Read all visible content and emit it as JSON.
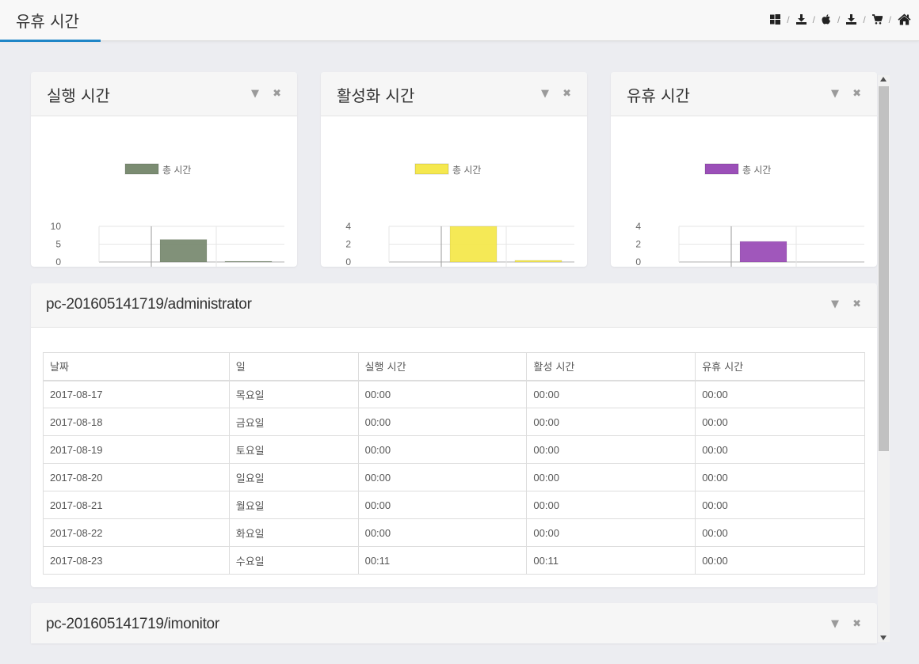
{
  "header": {
    "title": "유휴 시간",
    "icons": [
      "windows-icon",
      "download-icon",
      "apple-icon",
      "download-icon",
      "cart-icon",
      "home-icon"
    ],
    "separator": "/"
  },
  "charts": [
    {
      "title": "실행 시간",
      "chart_data": {
        "type": "bar",
        "legend": "총 시간",
        "color": "#7b8c72",
        "categories": [
          "pc-201605141719/imonitor",
          "pc-201605141719/administrator"
        ],
        "values": [
          6.3,
          0.18
        ],
        "ylim": [
          0,
          10
        ],
        "yticks": [
          "10",
          "5",
          "0"
        ]
      }
    },
    {
      "title": "활성화 시간",
      "chart_data": {
        "type": "bar",
        "legend": "총 시간",
        "color": "#f5e84e",
        "categories": [
          "pc-201605141719/imonitor",
          "pc-201605141719/administrator"
        ],
        "values": [
          4.0,
          0.18
        ],
        "ylim": [
          0,
          4
        ],
        "yticks": [
          "4",
          "2",
          "0"
        ]
      }
    },
    {
      "title": "유휴 시간",
      "chart_data": {
        "type": "bar",
        "legend": "총 시간",
        "color": "#9b4fb8",
        "categories": [
          "pc-201605141719/imonitor",
          "pc-201605141719/administrator"
        ],
        "values": [
          2.3,
          0
        ],
        "ylim": [
          0,
          4
        ],
        "yticks": [
          "4",
          "2",
          "0"
        ]
      }
    }
  ],
  "panel_admin": {
    "title": "pc-201605141719/administrator",
    "columns": [
      "날짜",
      "일",
      "실행 시간",
      "활성 시간",
      "유휴 시간"
    ],
    "rows": [
      [
        "2017-08-17",
        "목요일",
        "00:00",
        "00:00",
        "00:00"
      ],
      [
        "2017-08-18",
        "금요일",
        "00:00",
        "00:00",
        "00:00"
      ],
      [
        "2017-08-19",
        "토요일",
        "00:00",
        "00:00",
        "00:00"
      ],
      [
        "2017-08-20",
        "일요일",
        "00:00",
        "00:00",
        "00:00"
      ],
      [
        "2017-08-21",
        "월요일",
        "00:00",
        "00:00",
        "00:00"
      ],
      [
        "2017-08-22",
        "화요일",
        "00:00",
        "00:00",
        "00:00"
      ],
      [
        "2017-08-23",
        "수요일",
        "00:11",
        "00:11",
        "00:00"
      ]
    ]
  },
  "panel_imonitor": {
    "title": "pc-201605141719/imonitor"
  },
  "controls": {
    "collapse_glyph": "▼",
    "close_glyph": "✖"
  }
}
